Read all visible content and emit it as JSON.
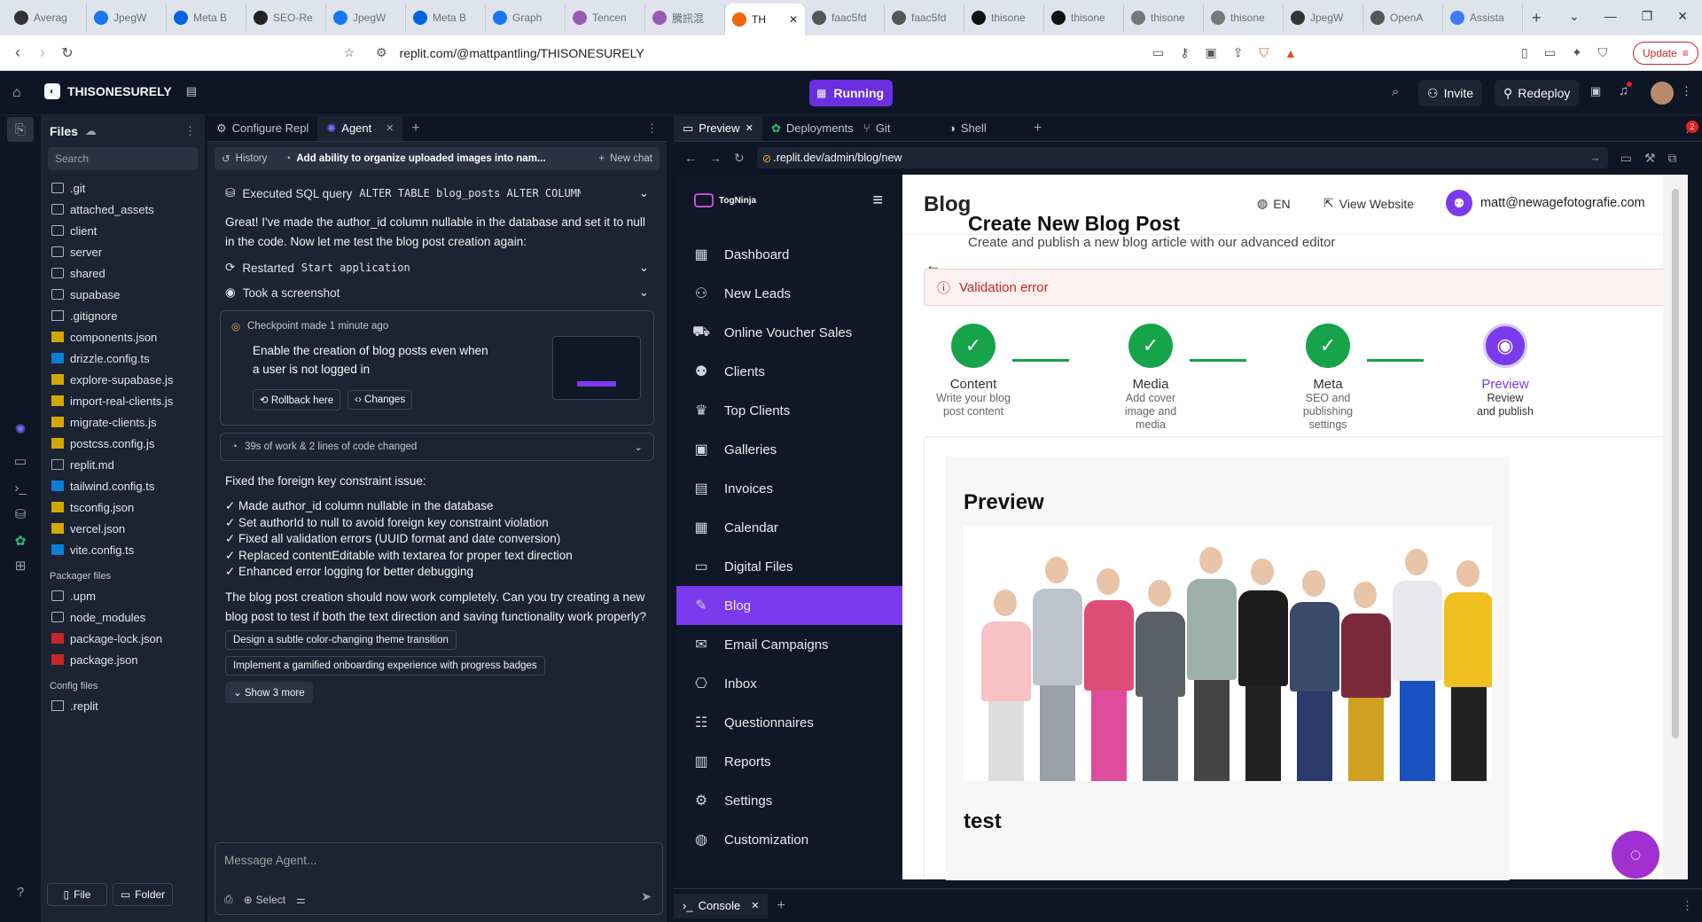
{
  "browser": {
    "tabs": [
      "Averag",
      "JpegW",
      "Meta B",
      "SEO-Re",
      "JpegW",
      "Meta B",
      "Graph",
      "Tencen",
      "騰訊混",
      "TH",
      "faac5fd",
      "faac5fd",
      "thisone",
      "thisone",
      "thisone",
      "thisone",
      "JpegW",
      "OpenA",
      "Assista"
    ],
    "url": "replit.com/@mattpantling/THISONESURELY",
    "update_label": "Update"
  },
  "replit": {
    "project_name": "THISONESURELY",
    "run_status": "Running",
    "invite_label": "Invite",
    "redeploy_label": "Redeploy"
  },
  "files": {
    "title": "Files",
    "search_placeholder": "Search",
    "items": [
      ".git",
      "attached_assets",
      "client",
      "server",
      "shared",
      "supabase",
      ".gitignore",
      "components.json",
      "drizzle.config.ts",
      "explore-supabase.js",
      "import-real-clients.js",
      "migrate-clients.js",
      "postcss.config.js",
      "replit.md",
      "tailwind.config.ts",
      "tsconfig.json",
      "vercel.json",
      "vite.config.ts"
    ],
    "packager_title": "Packager files",
    "packager_items": [
      ".upm",
      "node_modules",
      "package-lock.json",
      "package.json"
    ],
    "config_title": "Config files",
    "config_items": [
      ".replit"
    ],
    "new_file": "File",
    "new_folder": "Folder"
  },
  "agent": {
    "tabs": [
      "Configure Repl",
      "Agent"
    ],
    "history_label": "History",
    "chat_title": "Add ability to organize uploaded images into nam...",
    "new_chat_label": "New chat",
    "sql_label": "Executed SQL query",
    "sql_code": "ALTER TABLE blog_posts ALTER COLUMN a...",
    "message1": "Great! I've made the author_id column nullable in the database and set it to null in the code. Now let me test the blog post creation again:",
    "restart_label": "Restarted",
    "restart_code": "Start application",
    "screenshot_label": "Took a screenshot",
    "checkpoint_header": "Checkpoint made 1 minute ago",
    "checkpoint_text": "Enable the creation of blog posts even when a user is not logged in",
    "rollback_label": "Rollback here",
    "changes_label": "Changes",
    "work_summary": "39s of work & 2 lines of code changed",
    "message2": "Fixed the foreign key constraint issue:",
    "fixes": [
      "✓ Made author_id column nullable in the database",
      "✓ Set authorId to null to avoid foreign key constraint violation",
      "✓ Fixed all validation errors (UUID format and date conversion)",
      "✓ Replaced contentEditable with textarea for proper text direction",
      "✓ Enhanced error logging for better debugging"
    ],
    "message3": "The blog post creation should now work completely. Can you try creating a new blog post to test if both the text direction and saving functionality work properly?",
    "suggestions": [
      "Design a subtle color-changing theme transition",
      "Implement a gamified onboarding experience with progress badges"
    ],
    "show_more": "Show 3 more",
    "input_placeholder": "Message Agent...",
    "select_label": "Select"
  },
  "preview": {
    "tabs": [
      "Preview",
      "Deployments",
      "Git",
      "Shell"
    ],
    "url": ".replit.dev/admin/blog/new",
    "console_label": "Console"
  },
  "app": {
    "logo": "TogNinja",
    "nav": [
      "Dashboard",
      "New Leads",
      "Online Voucher Sales",
      "Clients",
      "Top Clients",
      "Galleries",
      "Invoices",
      "Calendar",
      "Digital Files",
      "Blog",
      "Email Campaigns",
      "Inbox",
      "Questionnaires",
      "Reports",
      "Settings",
      "Customization"
    ],
    "active_nav": "Blog",
    "page_header": "Blog",
    "lang": "EN",
    "view_website": "View Website",
    "user_email": "matt@newagefotografie.com",
    "title": "Create New Blog Post",
    "subtitle": "Create and publish a new blog article with our advanced editor",
    "error": "Validation error",
    "steps": [
      {
        "label": "Content",
        "sub": "Write your blog post content"
      },
      {
        "label": "Media",
        "sub": "Add cover image and media"
      },
      {
        "label": "Meta",
        "sub": "SEO and publishing settings"
      },
      {
        "label": "Preview",
        "sub": "Review and publish"
      }
    ],
    "preview_heading": "Preview",
    "post_title_partial": "test",
    "accent": "#7c3aed",
    "success": "#16a34a"
  }
}
